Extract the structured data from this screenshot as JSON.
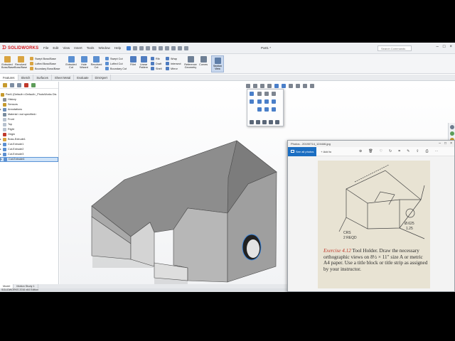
{
  "app": {
    "logo": "SOLIDWORKS",
    "menu": [
      "File",
      "Edit",
      "View",
      "Insert",
      "Tools",
      "Window",
      "Help"
    ],
    "doc_title": "Part1 *",
    "search_placeholder": "Search Commands",
    "window_controls": [
      "–",
      "□",
      "×"
    ]
  },
  "command_manager": {
    "large_tools": [
      {
        "name": "extruded-boss",
        "label": "Extruded Boss/Base",
        "color": "#d9a441"
      },
      {
        "name": "revolved-boss",
        "label": "Revolved Boss/Base",
        "color": "#d9a441"
      },
      {
        "name": "extruded-cut",
        "label": "Extruded Cut",
        "color": "#5b8fd1"
      },
      {
        "name": "hole-wizard",
        "label": "Hole Wizard",
        "color": "#5b8fd1"
      },
      {
        "name": "revolved-cut",
        "label": "Revolved Cut",
        "color": "#5b8fd1"
      },
      {
        "name": "fillet",
        "label": "Fillet",
        "color": "#4f7cc0"
      },
      {
        "name": "linear-pattern",
        "label": "Linear Pattern",
        "color": "#4f7cc0"
      },
      {
        "name": "reference-geometry",
        "label": "Reference Geometry",
        "color": "#6e7f95"
      },
      {
        "name": "curves",
        "label": "Curves",
        "color": "#6e7f95"
      }
    ],
    "small_tools": [
      {
        "name": "swept-boss",
        "label": "Swept Boss/Base"
      },
      {
        "name": "lofted-boss",
        "label": "Lofted Boss/Base"
      },
      {
        "name": "boundary-boss",
        "label": "Boundary Boss/Base"
      },
      {
        "name": "swept-cut",
        "label": "Swept Cut"
      },
      {
        "name": "lofted-cut",
        "label": "Lofted Cut"
      },
      {
        "name": "boundary-cut",
        "label": "Boundary Cut"
      },
      {
        "name": "rib",
        "label": "Rib"
      },
      {
        "name": "draft",
        "label": "Draft"
      },
      {
        "name": "shell",
        "label": "Shell"
      },
      {
        "name": "wrap",
        "label": "Wrap"
      },
      {
        "name": "intersect",
        "label": "Intersect"
      },
      {
        "name": "mirror",
        "label": "Mirror"
      }
    ],
    "section_view": "Section View"
  },
  "tabs": [
    "Features",
    "Sketch",
    "Surfaces",
    "Sheet Metal",
    "Evaluate",
    "DimXpert"
  ],
  "active_tab": "Features",
  "tree": {
    "root": "Part1 (Default<<Default>_PhotoWorks Dis",
    "items": [
      {
        "label": "History",
        "arrow": "",
        "icon": "#8a8f96",
        "selected": false
      },
      {
        "label": "Sensors",
        "arrow": "",
        "icon": "#c69a2e",
        "selected": false
      },
      {
        "label": "Annotations",
        "arrow": "▸",
        "icon": "#6f8fb8",
        "selected": false
      },
      {
        "label": "Material <not specified>",
        "arrow": "",
        "icon": "#7a8c9e",
        "selected": false
      },
      {
        "label": "Front",
        "arrow": "",
        "icon": "#b8c2cf",
        "selected": false
      },
      {
        "label": "Top",
        "arrow": "",
        "icon": "#b8c2cf",
        "selected": false
      },
      {
        "label": "Right",
        "arrow": "",
        "icon": "#b8c2cf",
        "selected": false
      },
      {
        "label": "Origin",
        "arrow": "",
        "icon": "#c0392b",
        "selected": false
      },
      {
        "label": "Boss-Extrude1",
        "arrow": "▸",
        "icon": "#d9a441",
        "selected": false
      },
      {
        "label": "Cut-Extrude1",
        "arrow": "▸",
        "icon": "#5b8fd1",
        "selected": false
      },
      {
        "label": "Cut-Extrude2",
        "arrow": "▸",
        "icon": "#5b8fd1",
        "selected": false
      },
      {
        "label": "Cut-Extrude3",
        "arrow": "▸",
        "icon": "#5b8fd1",
        "selected": false
      },
      {
        "label": "Cut-Extrude4",
        "arrow": "▸",
        "icon": "#5b8fd1",
        "selected": true
      }
    ]
  },
  "bottom_tabs": [
    "Model",
    "Motion Study 1"
  ],
  "status_text": "SOLIDWORKS 2016 x64 Edition",
  "photos": {
    "title": "Photos - 20190714_124446.jpg",
    "see_all": "See all photos",
    "add_to": "+ Add to",
    "icons": [
      "zoom-icon",
      "delete-icon",
      "favorite-icon",
      "rotate-icon",
      "crop-icon",
      "edit-icon",
      "share-icon",
      "print-icon",
      "more-icon"
    ],
    "exercise_number": "Exercise 4.12",
    "exercise_text": "Tool Holder. Draw the necessary orthographic views on 8½ × 11″ size A or metric A4 paper. Use a title block or title strip as assigned by your instructor.",
    "drawing_labels": [
      "CRS",
      "2 REQD",
      "Ø.625",
      "1.25"
    ]
  },
  "colors": {
    "accent": "#1b6ec2",
    "brand": "#d5161c",
    "selection": "#cfe3f8"
  }
}
